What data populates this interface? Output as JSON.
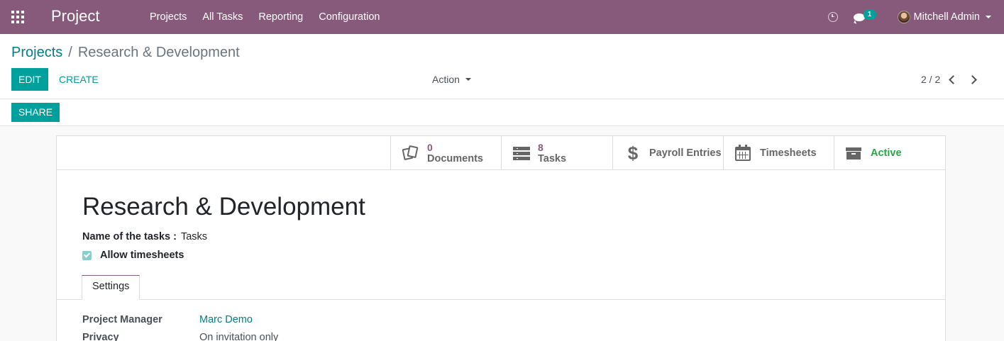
{
  "navbar": {
    "brand": "Project",
    "menu": [
      "Projects",
      "All Tasks",
      "Reporting",
      "Configuration"
    ],
    "chat_count": "1",
    "user_name": "Mitchell Admin",
    "color": "#875a7b"
  },
  "breadcrumb": {
    "parent": "Projects",
    "separator": "/",
    "current": "Research & Development"
  },
  "toolbar": {
    "edit_label": "EDIT",
    "create_label": "CREATE",
    "action_label": "Action",
    "pager": "2 / 2"
  },
  "statusbar": {
    "share_label": "SHARE"
  },
  "stat_buttons": {
    "documents": {
      "value": "0",
      "label": "Documents",
      "icon": "documents-icon"
    },
    "tasks": {
      "value": "8",
      "label": "Tasks",
      "icon": "tasks-icon"
    },
    "payroll": {
      "label": "Payroll Entries",
      "icon": "dollar-icon"
    },
    "timesheets": {
      "label": "Timesheets",
      "icon": "calendar-icon"
    },
    "active": {
      "label": "Active",
      "icon": "archive-icon"
    }
  },
  "form": {
    "title": "Research & Development",
    "task_name_label": "Name of the tasks :",
    "task_name_value": "Tasks",
    "allow_timesheets_label": "Allow timesheets",
    "allow_timesheets_checked": true,
    "tab_label": "Settings",
    "project_manager_label": "Project Manager",
    "project_manager_value": "Marc Demo",
    "privacy_label": "Privacy",
    "privacy_value": "On invitation only"
  },
  "colors": {
    "primary": "#00a09d",
    "link": "#017e84",
    "active": "#28a745"
  }
}
